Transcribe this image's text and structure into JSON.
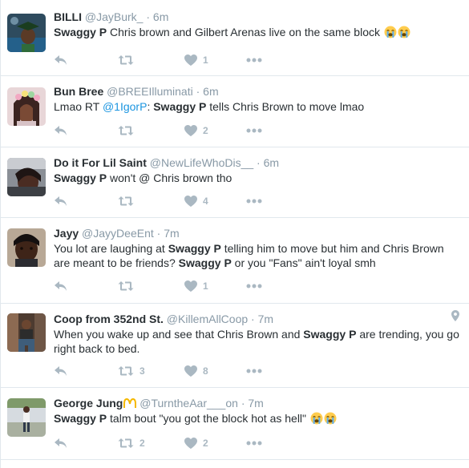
{
  "colors": {
    "muted": "#8899a6",
    "icon": "#aab8c2",
    "link": "#1b95e0",
    "border": "#e1e8ed"
  },
  "tweets": [
    {
      "name": "BILLI",
      "handle": "@JayBurk_",
      "sep": "·",
      "time": "6m",
      "segments": [
        {
          "t": "Swaggy P",
          "b": true
        },
        {
          "t": " Chris brown and Gilbert Arenas live on the same block "
        },
        {
          "emoji": "crying-face"
        },
        {
          "emoji": "crying-face"
        }
      ],
      "counts": {
        "reply": "",
        "retweet": "",
        "like": "1"
      },
      "avatar": "avatar-graduate"
    },
    {
      "name": "Bun Bree",
      "handle": "@BREEIlluminati",
      "sep": "·",
      "time": "6m",
      "segments": [
        {
          "t": "Lmao RT "
        },
        {
          "t": "@1IgorP",
          "link": true
        },
        {
          "t": ": "
        },
        {
          "t": "Swaggy P",
          "b": true
        },
        {
          "t": " tells Chris Brown to move lmao"
        }
      ],
      "counts": {
        "reply": "",
        "retweet": "",
        "like": "2"
      },
      "avatar": "avatar-flowercrown"
    },
    {
      "name": "Do it For Lil Saint",
      "handle": "@NewLifeWhoDis__",
      "sep": "·",
      "time": "6m",
      "segments": [
        {
          "t": "Swaggy P",
          "b": true
        },
        {
          "t": " won't @ Chris brown tho"
        }
      ],
      "counts": {
        "reply": "",
        "retweet": "",
        "like": "4"
      },
      "avatar": "avatar-car"
    },
    {
      "name": "Jayy",
      "handle": "@JayyDeeEnt",
      "sep": "·",
      "time": "7m",
      "segments": [
        {
          "t": "You lot are laughing at "
        },
        {
          "t": "Swaggy P",
          "b": true
        },
        {
          "t": " telling him to move but him and Chris Brown are meant to be friends? "
        },
        {
          "t": "Swaggy P",
          "b": true
        },
        {
          "t": " or you \"Fans\" ain't loyal smh"
        }
      ],
      "counts": {
        "reply": "",
        "retweet": "",
        "like": "1"
      },
      "avatar": "avatar-selfie"
    },
    {
      "name": "Coop from 352nd St.",
      "handle": "@KillemAllCoop",
      "sep": "·",
      "time": "7m",
      "segments": [
        {
          "t": "When you wake up and see that Chris Brown and "
        },
        {
          "t": "Swaggy P",
          "b": true
        },
        {
          "t": " are trending, you go right back to bed."
        }
      ],
      "counts": {
        "reply": "",
        "retweet": "3",
        "like": "8"
      },
      "avatar": "avatar-sitting",
      "location_icon": true
    },
    {
      "name": "George Jung",
      "handle": "@TurntheAar___on",
      "sep": "·",
      "time": "7m",
      "name_emoji": "mcdonalds-arches",
      "segments": [
        {
          "t": "Swaggy P",
          "b": true
        },
        {
          "t": " talm bout \"you got the block hot as hell\" "
        },
        {
          "emoji": "crying-face"
        },
        {
          "emoji": "crying-face"
        }
      ],
      "counts": {
        "reply": "",
        "retweet": "2",
        "like": "2"
      },
      "avatar": "avatar-standing"
    }
  ]
}
